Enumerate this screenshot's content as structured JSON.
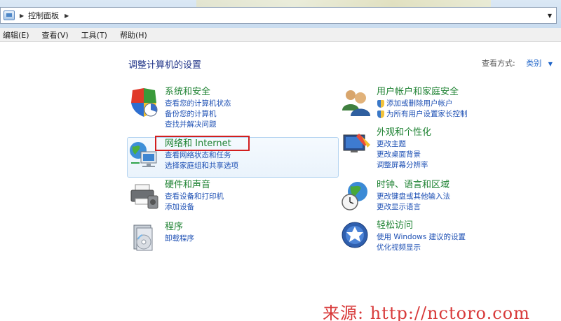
{
  "address_bar": {
    "breadcrumb": "控制面板"
  },
  "menu": {
    "items": [
      "编辑(E)",
      "查看(V)",
      "工具(T)",
      "帮助(H)"
    ]
  },
  "main": {
    "heading": "调整计算机的设置",
    "view_by_label": "查看方式:",
    "view_by_value": "类别"
  },
  "categories": {
    "system_security": {
      "title": "系统和安全",
      "links": [
        "查看您的计算机状态",
        "备份您的计算机",
        "查找并解决问题"
      ]
    },
    "network": {
      "title": "网络和 Internet",
      "links": [
        "查看网络状态和任务",
        "选择家庭组和共享选项"
      ]
    },
    "hardware": {
      "title": "硬件和声音",
      "links": [
        "查看设备和打印机",
        "添加设备"
      ]
    },
    "programs": {
      "title": "程序",
      "links": [
        "卸载程序"
      ]
    },
    "user_accounts": {
      "title": "用户帐户和家庭安全",
      "links": [
        "添加或删除用户帐户",
        "为所有用户设置家长控制"
      ]
    },
    "appearance": {
      "title": "外观和个性化",
      "links": [
        "更改主题",
        "更改桌面背景",
        "调整屏幕分辨率"
      ]
    },
    "clock_region": {
      "title": "时钟、语言和区域",
      "links": [
        "更改键盘或其他输入法",
        "更改显示语言"
      ]
    },
    "ease_access": {
      "title": "轻松访问",
      "links": [
        "使用 Windows 建议的设置",
        "优化视频显示"
      ]
    }
  },
  "watermark": "来源: http://nctoro.com",
  "colors": {
    "category_title": "#1e8232",
    "link": "#1e50b4",
    "heading": "#1e3287",
    "highlight_red": "#d21e1e"
  }
}
